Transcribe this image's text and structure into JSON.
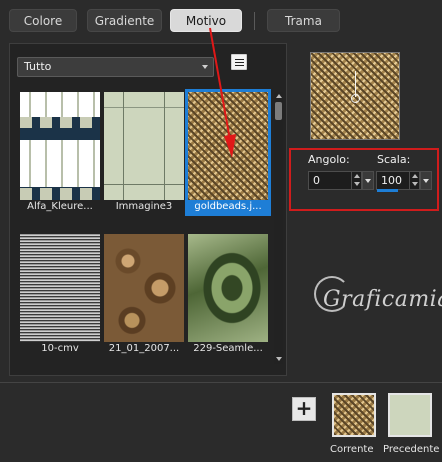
{
  "tabs": [
    {
      "label": "Colore",
      "active": false
    },
    {
      "label": "Gradiente",
      "active": false
    },
    {
      "label": "Motivo",
      "active": true
    },
    {
      "label": "Trama",
      "active": false
    }
  ],
  "filter": {
    "selected": "Tutto"
  },
  "thumbnails": [
    {
      "caption": "Alfa_Kleure...",
      "selected": false
    },
    {
      "caption": "Immagine3",
      "selected": false
    },
    {
      "caption": "goldbeads.j...",
      "selected": true
    },
    {
      "caption": "10-cmv",
      "selected": false
    },
    {
      "caption": "21_01_2007...",
      "selected": false
    },
    {
      "caption": "229-Seamle...",
      "selected": false
    }
  ],
  "controls": {
    "angolo_label": "Angolo:",
    "angolo_value": "0",
    "scala_label": "Scala:",
    "scala_value": "100"
  },
  "watermark": "Graficamia",
  "swatches": {
    "corrente_label": "Corrente",
    "precedente_label": "Precedente"
  },
  "add_label": "+",
  "colors": {
    "selection": "#1e7ed6",
    "highlight_box": "#d01c1c",
    "background": "#2b2b2b"
  }
}
